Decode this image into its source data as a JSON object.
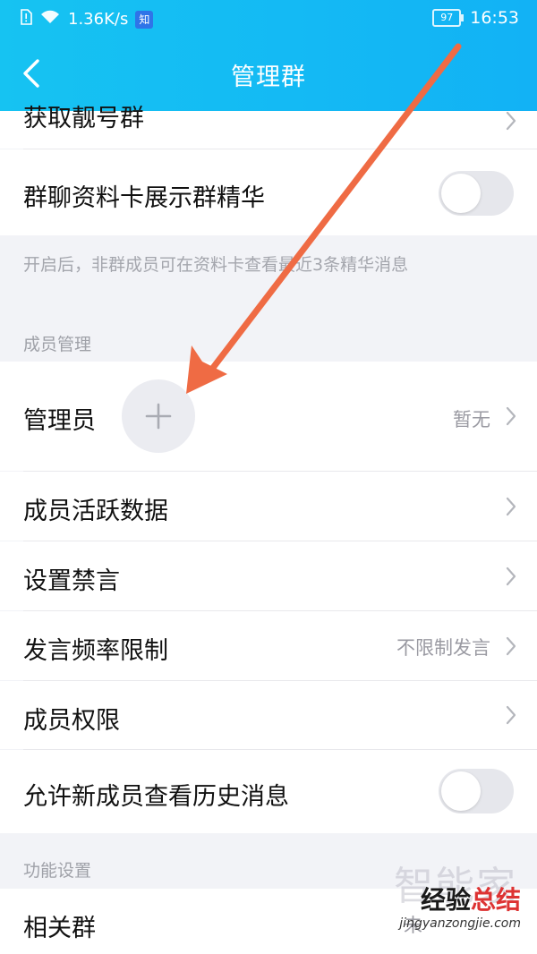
{
  "status_bar": {
    "speed": "1.36K/s",
    "app_badge": "知",
    "battery": "97",
    "time": "16:53"
  },
  "nav": {
    "title": "管理群"
  },
  "rows": {
    "pretty_number_group": {
      "label": "获取靓号群"
    },
    "show_essence": {
      "label": "群聊资料卡展示群精华",
      "enabled": false
    },
    "essence_note": "开启后，非群成员可在资料卡查看最近3条精华消息",
    "member_section_header": "成员管理",
    "admin": {
      "label": "管理员",
      "value": "暂无"
    },
    "active_data": {
      "label": "成员活跃数据"
    },
    "mute": {
      "label": "设置禁言"
    },
    "rate_limit": {
      "label": "发言频率限制",
      "value": "不限制发言"
    },
    "permissions": {
      "label": "成员权限"
    },
    "history": {
      "label": "允许新成员查看历史消息",
      "enabled": false
    },
    "function_section_header": "功能设置",
    "related_group": {
      "label": "相关群",
      "value": "未"
    }
  },
  "watermark": {
    "ghost": "智能家",
    "main_black": "经验",
    "main_red": "总结",
    "url": "jingyanzongjie.com"
  },
  "colors": {
    "header": "#12b2f5",
    "arrow": "#ef6b44"
  }
}
